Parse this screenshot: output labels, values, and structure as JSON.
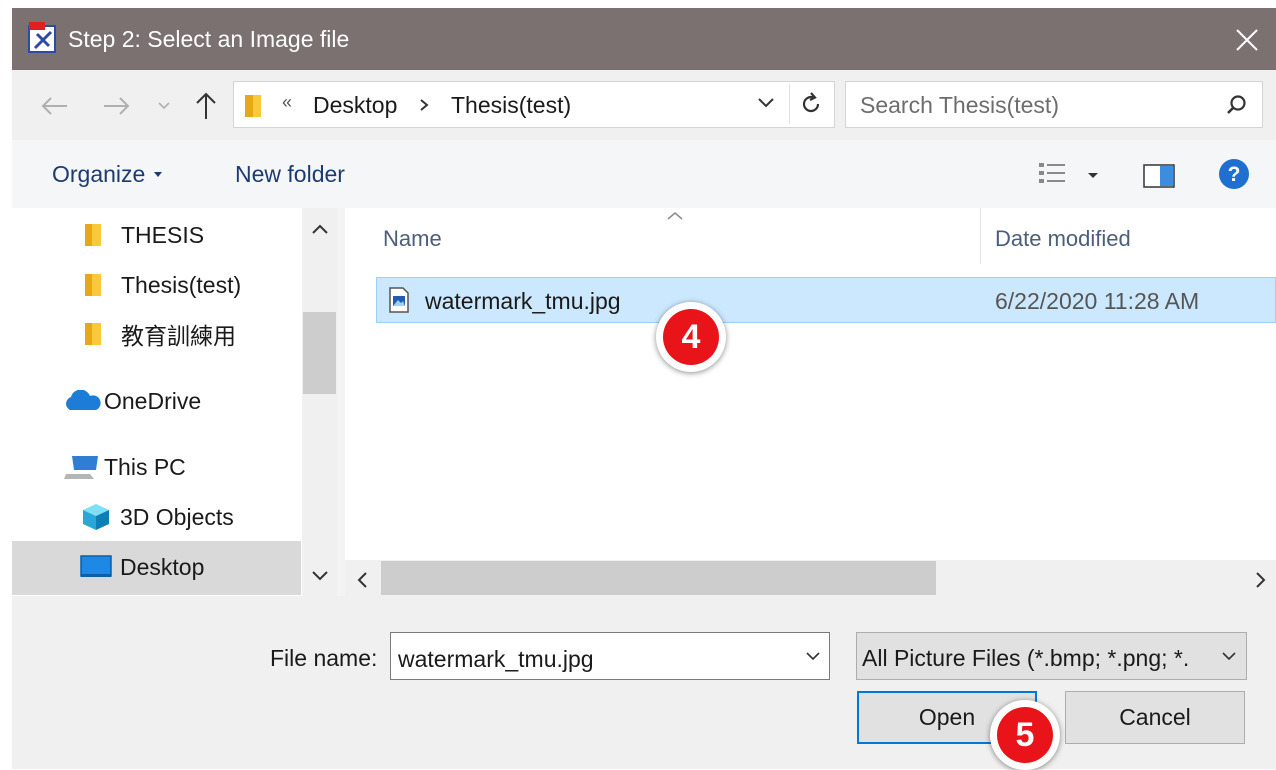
{
  "window": {
    "title": "Step 2: Select an Image file",
    "icons": {
      "app": "image-tool-icon",
      "close": "close-icon"
    }
  },
  "address": {
    "breadcrumb": [
      "Desktop",
      "Thesis(test)"
    ],
    "overflow_glyph": "«",
    "icons": [
      "back-arrow-icon",
      "forward-arrow-icon",
      "chevron-down-icon",
      "up-arrow-icon",
      "folder-icon",
      "refresh-icon"
    ]
  },
  "search": {
    "placeholder": "Search Thesis(test)",
    "icon": "search-icon"
  },
  "toolbar": {
    "organize_label": "Organize",
    "new_folder_label": "New folder",
    "icons": [
      "view-options-icon",
      "preview-pane-icon",
      "help-icon"
    ]
  },
  "nav": {
    "items": [
      {
        "label": "THESIS",
        "icon": "folder-icon"
      },
      {
        "label": "Thesis(test)",
        "icon": "folder-icon"
      },
      {
        "label": "教育訓練用",
        "icon": "folder-icon"
      },
      {
        "label": "OneDrive",
        "icon": "cloud-icon"
      },
      {
        "label": "This PC",
        "icon": "computer-icon"
      },
      {
        "label": "3D Objects",
        "icon": "cube-icon"
      },
      {
        "label": "Desktop",
        "icon": "desktop-icon",
        "selected": true
      }
    ]
  },
  "file_list": {
    "columns": [
      "Name",
      "Date modified"
    ],
    "rows": [
      {
        "name": "watermark_tmu.jpg",
        "date_modified": "6/22/2020 11:28 AM",
        "icon": "image-file-icon",
        "selected": true
      }
    ]
  },
  "bottom": {
    "file_name_label": "File name:",
    "file_name_value": "watermark_tmu.jpg",
    "file_type_value": "All Picture Files (*.bmp; *.png; *.",
    "open_label": "Open",
    "cancel_label": "Cancel"
  },
  "markers": {
    "step4": "4",
    "step5": "5"
  },
  "colors": {
    "titlebar": "#7a7170",
    "selection": "#cce8ff",
    "accent": "#0078d7",
    "marker": "#e8141a"
  }
}
